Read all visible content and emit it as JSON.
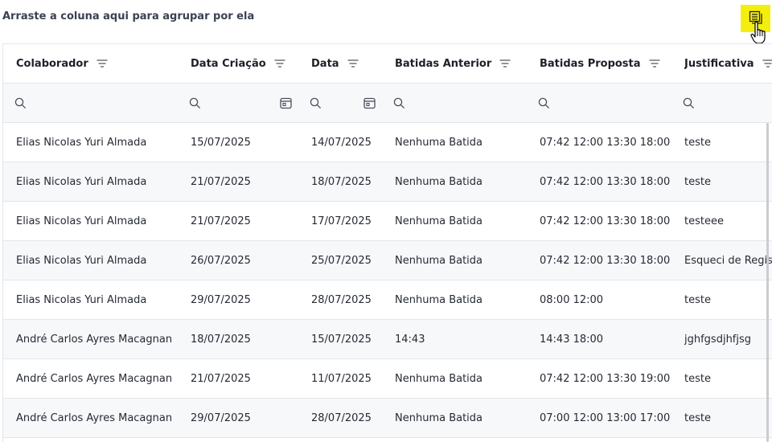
{
  "group_panel": {
    "text": "Arraste a coluna aqui para agrupar por ela"
  },
  "columns": [
    {
      "label": "Colaborador"
    },
    {
      "label": "Data Criação"
    },
    {
      "label": "Data"
    },
    {
      "label": "Batidas Anterior"
    },
    {
      "label": "Batidas Proposta"
    },
    {
      "label": "Justificativa"
    }
  ],
  "rows": [
    [
      "Elias Nicolas Yuri Almada",
      "15/07/2025",
      "14/07/2025",
      "Nenhuma Batida",
      "07:42 12:00 13:30 18:00",
      "teste"
    ],
    [
      "Elias Nicolas Yuri Almada",
      "21/07/2025",
      "18/07/2025",
      "Nenhuma Batida",
      "07:42 12:00 13:30 18:00",
      "teste"
    ],
    [
      "Elias Nicolas Yuri Almada",
      "21/07/2025",
      "17/07/2025",
      "Nenhuma Batida",
      "07:42 12:00 13:30 18:00",
      "testeee"
    ],
    [
      "Elias Nicolas Yuri Almada",
      "26/07/2025",
      "25/07/2025",
      "Nenhuma Batida",
      "07:42 12:00 13:30 18:00",
      "Esqueci de Registrar"
    ],
    [
      "Elias Nicolas Yuri Almada",
      "29/07/2025",
      "28/07/2025",
      "Nenhuma Batida",
      "08:00 12:00",
      "teste"
    ],
    [
      "André Carlos Ayres Macagnan",
      "18/07/2025",
      "15/07/2025",
      "14:43",
      "14:43 18:00",
      "jghfgsdjhfjsg"
    ],
    [
      "André Carlos Ayres Macagnan",
      "21/07/2025",
      "11/07/2025",
      "Nenhuma Batida",
      "07:42 12:00 13:30 19:00",
      "teste"
    ],
    [
      "André Carlos Ayres Macagnan",
      "29/07/2025",
      "28/07/2025",
      "Nenhuma Batida",
      "07:00 12:00 13:00 17:00",
      "teste"
    ]
  ]
}
